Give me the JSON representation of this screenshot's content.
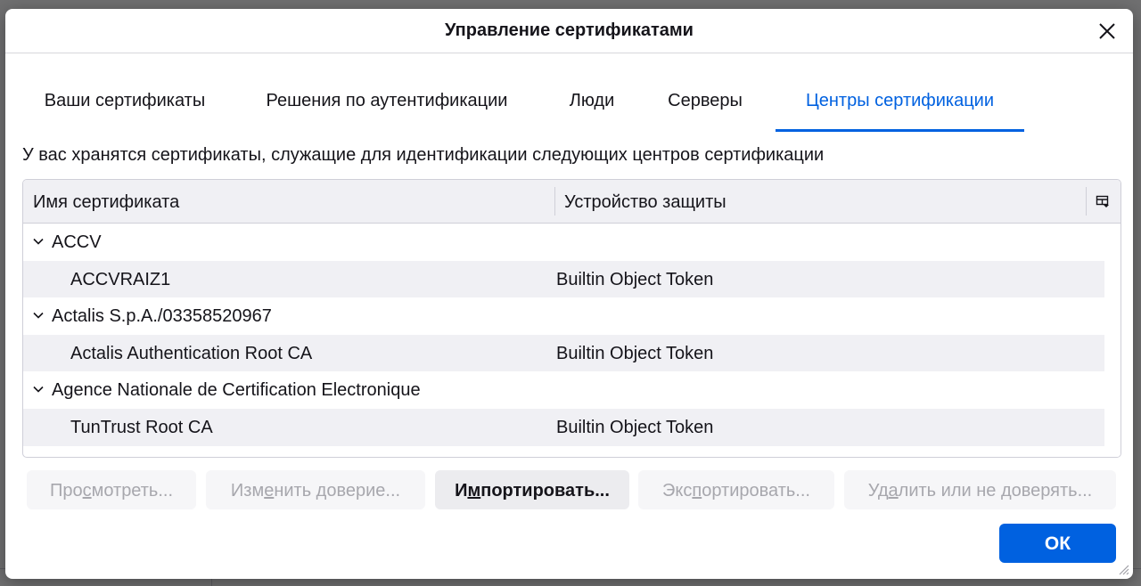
{
  "dialog": {
    "title": "Управление сертификатами",
    "close_icon": "close-icon"
  },
  "tabs": [
    {
      "label": "Ваши сертификаты",
      "selected": false
    },
    {
      "label": "Решения по аутентификации",
      "selected": false
    },
    {
      "label": "Люди",
      "selected": false
    },
    {
      "label": "Серверы",
      "selected": false
    },
    {
      "label": "Центры сертификации",
      "selected": true
    }
  ],
  "intro_text": "У вас хранятся сертификаты, служащие для идентификации следующих центров сертификации",
  "table": {
    "columns": [
      "Имя сертификата",
      "Устройство защиты"
    ],
    "column_picker_icon": "column-picker-icon",
    "groups": [
      {
        "name": "ACCV",
        "expanded": true,
        "children": [
          {
            "name": "ACCVRAIZ1",
            "device": "Builtin Object Token"
          }
        ]
      },
      {
        "name": "Actalis S.p.A./03358520967",
        "expanded": true,
        "children": [
          {
            "name": "Actalis Authentication Root CA",
            "device": "Builtin Object Token"
          }
        ]
      },
      {
        "name": "Agence Nationale de Certification Electronique",
        "expanded": true,
        "children": [
          {
            "name": "TunTrust Root CA",
            "device": "Builtin Object Token"
          }
        ]
      }
    ]
  },
  "buttons": {
    "view": {
      "pre": "Про",
      "key": "с",
      "post": "мотреть...",
      "enabled": false
    },
    "edit_trust": {
      "pre": "Изм",
      "key": "е",
      "post": "нить доверие...",
      "enabled": false
    },
    "import": {
      "pre": "И",
      "key": "м",
      "post": "портировать...",
      "enabled": true
    },
    "export": {
      "pre": "Экс",
      "key": "п",
      "post": "ортировать...",
      "enabled": false
    },
    "delete": {
      "pre": "Уд",
      "key": "а",
      "post": "лить или не доверять...",
      "enabled": false
    }
  },
  "ok_label": "ОК",
  "colors": {
    "accent": "#0061e0",
    "selected_row_bg": "#f0f0f4",
    "disabled_text": "#a7a7ad"
  }
}
